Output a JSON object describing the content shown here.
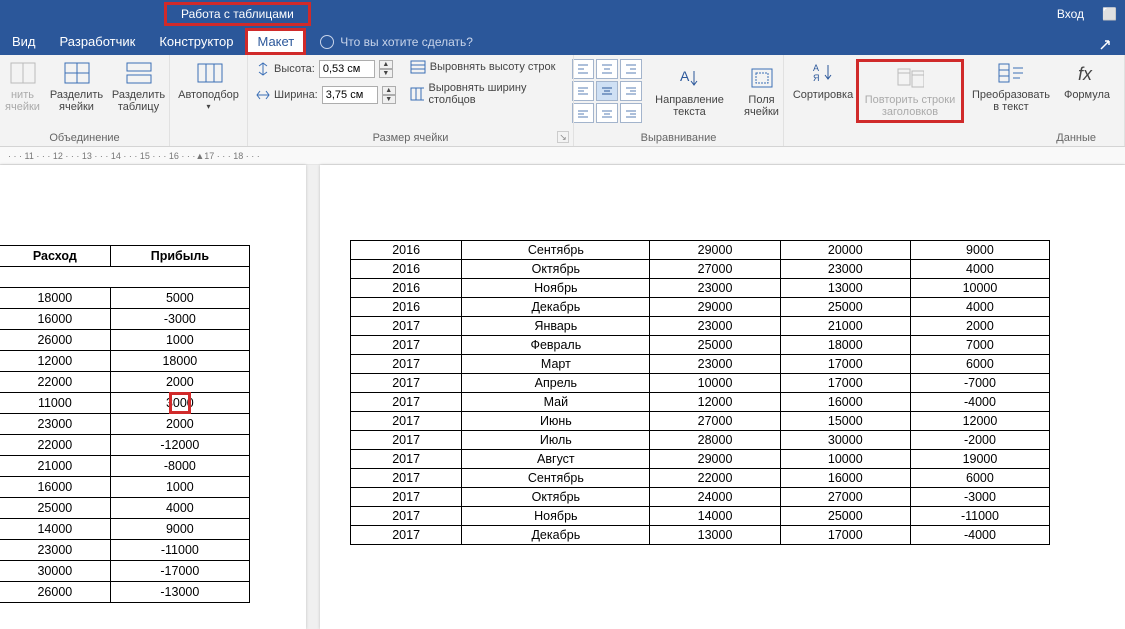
{
  "titlebar": {
    "contextual_title": "Работа с таблицами",
    "login": "Вход"
  },
  "tabs": {
    "view": "Вид",
    "developer": "Разработчик",
    "design": "Конструктор",
    "layout": "Макет",
    "tell_me": "Что вы хотите сделать?"
  },
  "ribbon": {
    "merge_group": "Объединение",
    "merge_split_cells": "нить\nячейки",
    "split_cells": "Разделить\nячейки",
    "split_table": "Разделить\nтаблицу",
    "autofit": "Автоподбор",
    "cell_size_group": "Размер ячейки",
    "height_label": "Высота:",
    "height_value": "0,53 см",
    "width_label": "Ширина:",
    "width_value": "3,75 см",
    "distribute_rows": "Выровнять высоту строк",
    "distribute_cols": "Выровнять ширину столбцов",
    "alignment_group": "Выравнивание",
    "text_direction": "Направление\nтекста",
    "cell_margins": "Поля\nячейки",
    "data_group": "Данные",
    "sort": "Сортировка",
    "repeat_header": "Повторить строки\nзаголовков",
    "convert_text": "Преобразовать\nв текст",
    "formula": "Формула"
  },
  "ruler_text": "· · · 11 · · · 12 · · · 13 · · · 14 · · · 15 · · · 16 · · ·▲17 · · · 18 · · ·",
  "left_table": {
    "headers": [
      "Расход",
      "Прибыль"
    ],
    "rows": [
      [
        "18000",
        "5000"
      ],
      [
        "16000",
        "-3000"
      ],
      [
        "26000",
        "1000"
      ],
      [
        "12000",
        "18000"
      ],
      [
        "22000",
        "2000"
      ],
      [
        "11000",
        "3000"
      ],
      [
        "23000",
        "2000"
      ],
      [
        "22000",
        "-12000"
      ],
      [
        "21000",
        "-8000"
      ],
      [
        "16000",
        "1000"
      ],
      [
        "25000",
        "4000"
      ],
      [
        "14000",
        "9000"
      ],
      [
        "23000",
        "-11000"
      ],
      [
        "30000",
        "-17000"
      ],
      [
        "26000",
        "-13000"
      ]
    ],
    "cursor_row_index": 5
  },
  "right_table": {
    "rows": [
      [
        "2016",
        "Сентябрь",
        "29000",
        "20000",
        "9000"
      ],
      [
        "2016",
        "Октябрь",
        "27000",
        "23000",
        "4000"
      ],
      [
        "2016",
        "Ноябрь",
        "23000",
        "13000",
        "10000"
      ],
      [
        "2016",
        "Декабрь",
        "29000",
        "25000",
        "4000"
      ],
      [
        "2017",
        "Январь",
        "23000",
        "21000",
        "2000"
      ],
      [
        "2017",
        "Февраль",
        "25000",
        "18000",
        "7000"
      ],
      [
        "2017",
        "Март",
        "23000",
        "17000",
        "6000"
      ],
      [
        "2017",
        "Апрель",
        "10000",
        "17000",
        "-7000"
      ],
      [
        "2017",
        "Май",
        "12000",
        "16000",
        "-4000"
      ],
      [
        "2017",
        "Июнь",
        "27000",
        "15000",
        "12000"
      ],
      [
        "2017",
        "Июль",
        "28000",
        "30000",
        "-2000"
      ],
      [
        "2017",
        "Август",
        "29000",
        "10000",
        "19000"
      ],
      [
        "2017",
        "Сентябрь",
        "22000",
        "16000",
        "6000"
      ],
      [
        "2017",
        "Октябрь",
        "24000",
        "27000",
        "-3000"
      ],
      [
        "2017",
        "Ноябрь",
        "14000",
        "25000",
        "-11000"
      ],
      [
        "2017",
        "Декабрь",
        "13000",
        "17000",
        "-4000"
      ]
    ]
  }
}
